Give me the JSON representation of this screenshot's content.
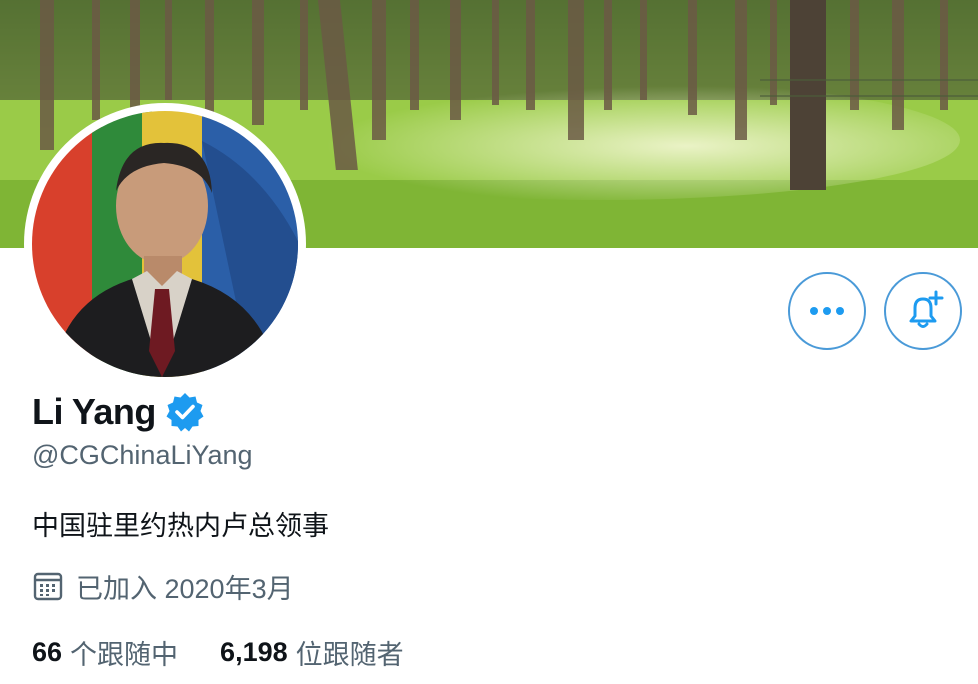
{
  "profile": {
    "display_name": "Li Yang",
    "handle": "@CGChinaLiYang",
    "bio": "中国驻里约热内卢总领事",
    "joined": "已加入 2020年3月",
    "following_count": "66",
    "following_label": "个跟随中",
    "followers_count": "6,198",
    "followers_label": "位跟随者",
    "verified": true
  },
  "icons": {
    "more": "more-dots-icon",
    "bell": "bell-plus-icon",
    "verified": "verified-badge-icon",
    "calendar": "calendar-icon"
  },
  "colors": {
    "accent": "#1d9bf0",
    "button_border": "#4a9ad8",
    "secondary_text": "#536471",
    "primary_text": "#0f1419"
  }
}
